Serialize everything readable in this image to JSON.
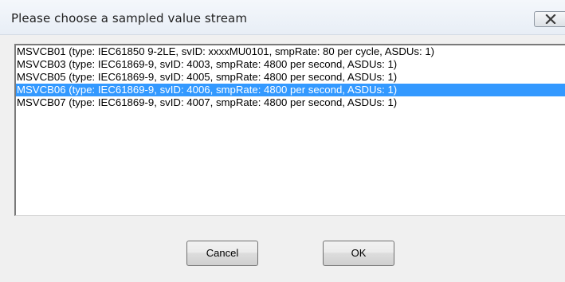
{
  "window": {
    "title": "Please choose a sampled value stream",
    "close_icon": "close-x-icon"
  },
  "streams": {
    "selected_index": 3,
    "items": [
      {
        "label": "MSVCB01 (type: IEC61850 9-2LE, svID: xxxxMU0101, smpRate: 80 per cycle, ASDUs: 1)"
      },
      {
        "label": "MSVCB03 (type: IEC61869-9, svID: 4003, smpRate: 4800 per second, ASDUs: 1)"
      },
      {
        "label": "MSVCB05 (type: IEC61869-9, svID: 4005, smpRate: 4800 per second, ASDUs: 1)"
      },
      {
        "label": "MSVCB06 (type: IEC61869-9, svID: 4006, smpRate: 4800 per second, ASDUs: 1)"
      },
      {
        "label": "MSVCB07 (type: IEC61869-9, svID: 4007, smpRate: 4800 per second, ASDUs: 1)"
      }
    ]
  },
  "buttons": {
    "cancel_label": "Cancel",
    "ok_label": "OK"
  },
  "colors": {
    "selection": "#3399ff",
    "selection_text": "#ffffff",
    "dialog_bg": "#f0f0f0"
  }
}
